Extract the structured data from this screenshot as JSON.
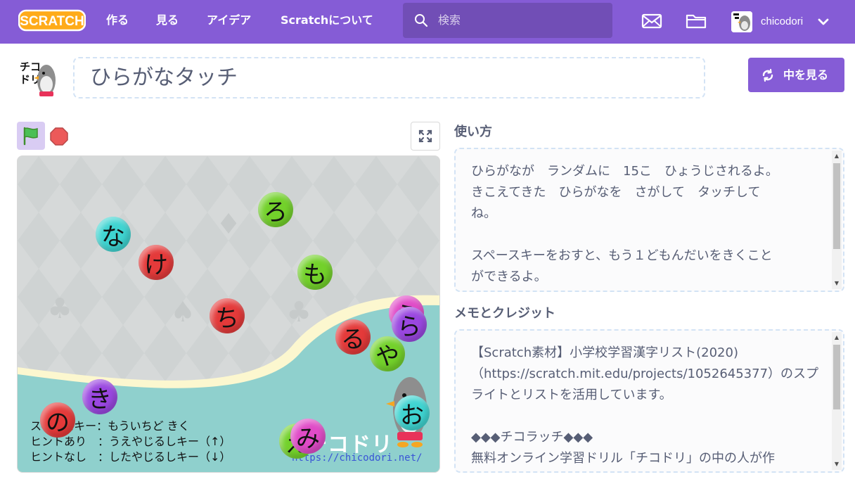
{
  "nav": {
    "logo_text": "SCRATCH",
    "links": [
      "作る",
      "見る",
      "アイデア",
      "Scratchについて"
    ],
    "search_placeholder": "検索",
    "username": "chicodori"
  },
  "project": {
    "title": "ひらがなタッチ",
    "see_inside_label": "中を見る"
  },
  "stage": {
    "letters": [
      "な",
      "け",
      "ろ",
      "も",
      "ち",
      "ら",
      "ら",
      "る",
      "や",
      "き",
      "の",
      "み",
      "え",
      "お"
    ],
    "lines": [
      "スペースキー：もういちど きく",
      "ヒントあり　：うえやじるしキー（↑）",
      "ヒントなし　：したやじるしキー（↓）"
    ],
    "logo_text": "チコドリ",
    "url": "https://chicodori.net/"
  },
  "instructions": {
    "label": "使い方",
    "text": "ひらがなが　ランダムに　15こ　ひょうじされるよ。\nきこえてきた　ひらがなを　さがして　タッチして\nね。\n\nスペースキーをおすと、もう１どもんだいをきくこと\nができるよ。"
  },
  "notes": {
    "label": "メモとクレジット",
    "text": "【Scratch素材】小学校学習漢字リスト(2020)\n（https://scratch.mit.edu/projects/1052645377）のスプ\nライトとリストを活用しています。\n\n◆◆◆チコラッチ◆◆◆\n無料オンライン学習ドリル「チコドリ」の中の人が作"
  },
  "colors": {
    "brand": "#855cd6",
    "search_bg": "#714eb6",
    "text": "#575e75",
    "stage_teal": "#8fd0cd"
  }
}
